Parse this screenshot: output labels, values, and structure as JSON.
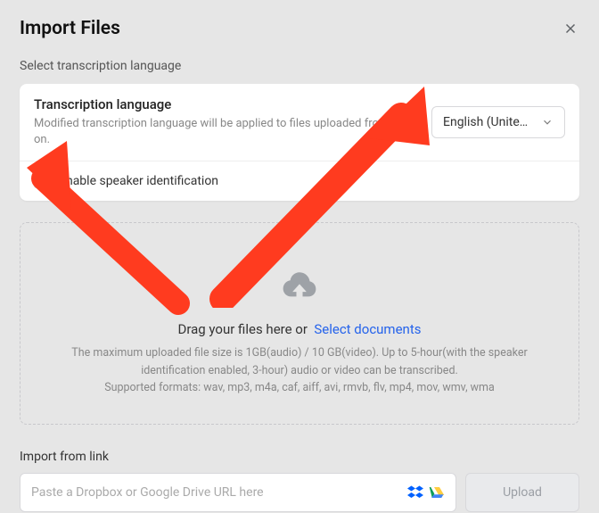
{
  "header": {
    "title": "Import Files"
  },
  "section_label": "Select transcription language",
  "lang": {
    "title": "Transcription language",
    "desc": "Modified transcription language will be applied to files uploaded from now on.",
    "selected": "English (United …"
  },
  "speaker": {
    "label": "Enable speaker identification"
  },
  "dropzone": {
    "drag_text": "Drag your files here or",
    "select_link": "Select documents",
    "line1": "The maximum uploaded file size is 1GB(audio) / 10 GB(video). Up to 5-hour(with the speaker identification enabled, 3-hour) audio or video can be transcribed.",
    "line2": "Supported formats: wav, mp3, m4a, caf, aiff, avi, rmvb, flv, mp4, mov, wmv, wma"
  },
  "link": {
    "label": "Import from link",
    "placeholder": "Paste a Dropbox or Google Drive URL here",
    "upload_label": "Upload"
  },
  "colors": {
    "accent": "#2563eb",
    "annotation": "#ff3b1f"
  }
}
